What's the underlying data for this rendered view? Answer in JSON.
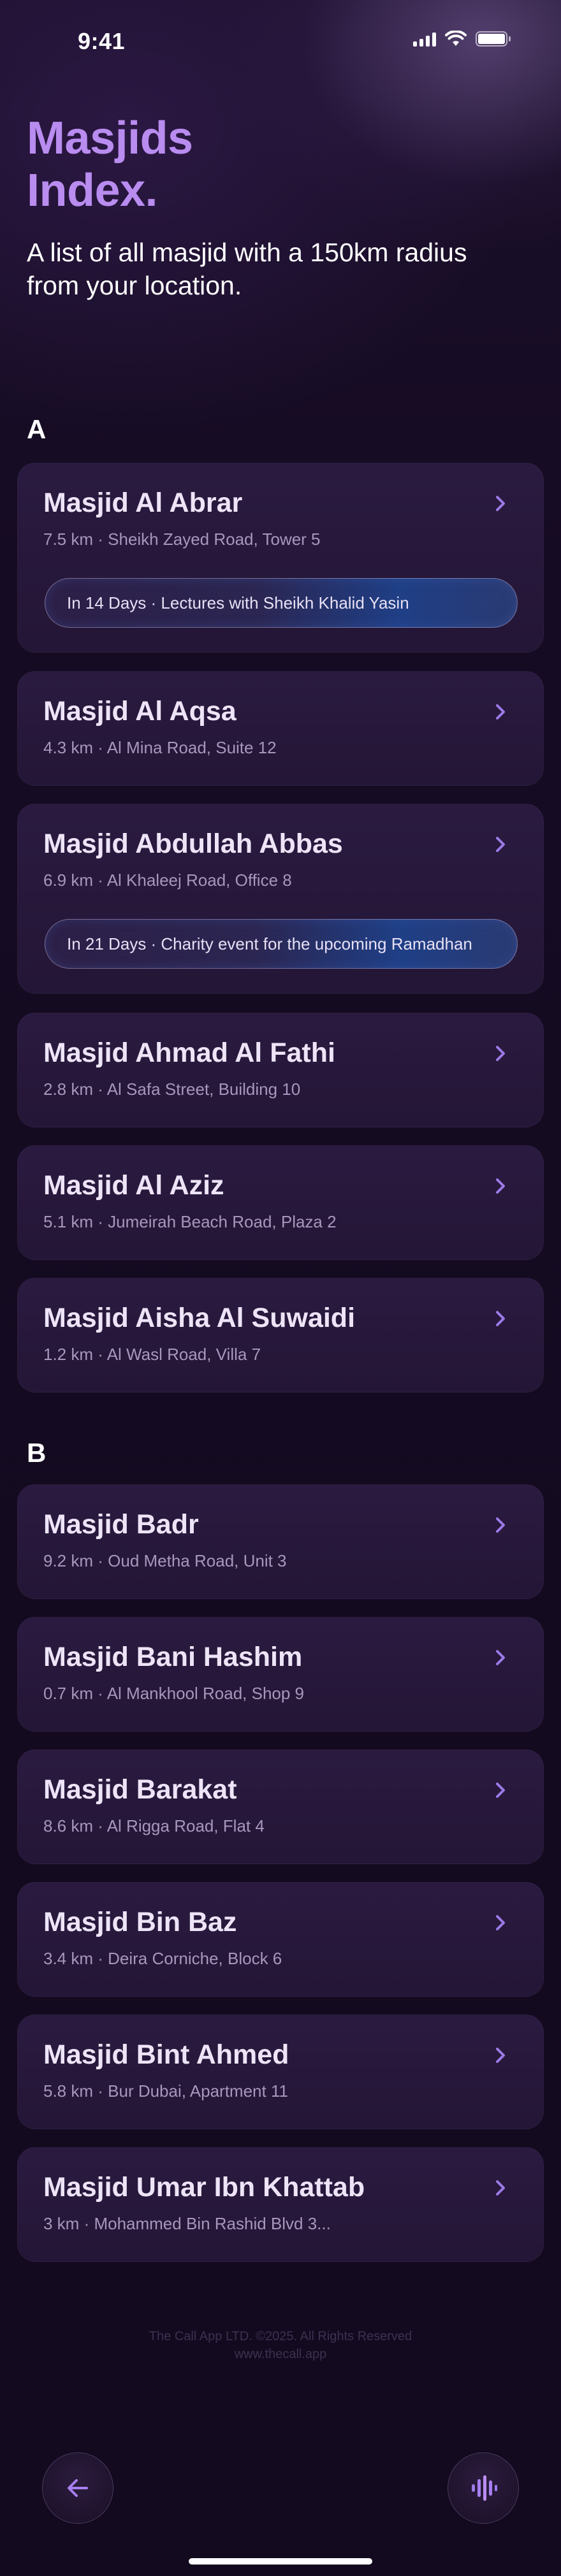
{
  "status_bar": {
    "time": "9:41"
  },
  "header": {
    "title": "Masjids\nIndex.",
    "subtitle": "A list of all masjid with a 150km radius from your location."
  },
  "sections": [
    {
      "letter": "A",
      "items": [
        {
          "name": "Masjid Al Abrar",
          "distance": "7.5 km",
          "address": "Sheikh Zayed Road, Tower 5",
          "event": "In 14 Days · Lectures with Sheikh Khalid Yasin"
        },
        {
          "name": "Masjid Al Aqsa",
          "distance": "4.3 km",
          "address": "Al Mina Road, Suite 12"
        },
        {
          "name": "Masjid Abdullah Abbas",
          "distance": "6.9 km",
          "address": "Al Khaleej Road, Office 8",
          "event": "In 21 Days · Charity event for the upcoming Ramadhan"
        },
        {
          "name": "Masjid Ahmad Al Fathi",
          "distance": "2.8 km",
          "address": "Al Safa Street, Building 10"
        },
        {
          "name": "Masjid Al Aziz",
          "distance": "5.1 km",
          "address": "Jumeirah Beach Road, Plaza 2"
        },
        {
          "name": "Masjid Aisha Al Suwaidi",
          "distance": "1.2 km",
          "address": "Al Wasl Road, Villa 7"
        }
      ]
    },
    {
      "letter": "B",
      "items": [
        {
          "name": "Masjid Badr",
          "distance": "9.2 km",
          "address": "Oud Metha Road, Unit 3"
        },
        {
          "name": "Masjid Bani Hashim",
          "distance": "0.7 km",
          "address": "Al Mankhool Road, Shop 9"
        },
        {
          "name": "Masjid Barakat",
          "distance": "8.6 km",
          "address": "Al Rigga Road, Flat 4"
        },
        {
          "name": "Masjid Bin Baz",
          "distance": "3.4 km",
          "address": "Deira Corniche, Block 6"
        },
        {
          "name": "Masjid Bint Ahmed",
          "distance": "5.8 km",
          "address": "Bur Dubai, Apartment 11"
        },
        {
          "name": "Masjid Umar Ibn Khattab",
          "distance": "3 km",
          "address": "Mohammed Bin Rashid Blvd 3..."
        }
      ]
    }
  ],
  "footer": {
    "copyright": "The Call App LTD. ©2025. All Rights Reserved",
    "website": "www.thecall.app"
  },
  "icons": {
    "chevron": "chevron-right-icon",
    "back": "arrow-left-icon",
    "voice": "voice-waveform-icon"
  },
  "colors": {
    "accent": "#b98cf0",
    "background": "#140a1f",
    "card": "#271839",
    "chevron": "#9c7ae6"
  }
}
